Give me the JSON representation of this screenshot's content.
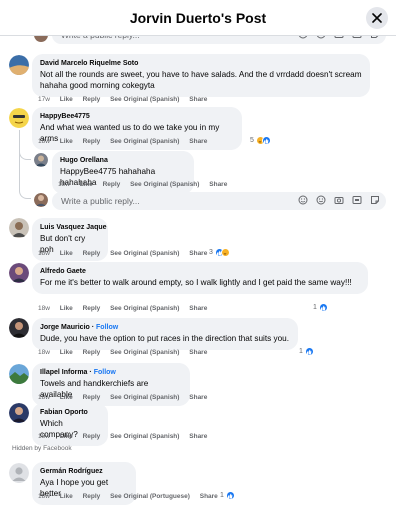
{
  "header": {
    "title": "Jorvin Duerto's Post"
  },
  "reply_placeholder": "Write a public reply...",
  "meta": {
    "like": "Like",
    "reply": "Reply",
    "see_original_spanish": "See Original (Spanish)",
    "see_original_portuguese": "See Original (Portuguese)",
    "share": "Share"
  },
  "comments": [
    {
      "author": "David Marcelo Riquelme Soto",
      "text": "Not all the rounds are sweet, you have to have salads. And the d vrrdadd doesn't scream hahaha good morning cokegyta",
      "time": "17w",
      "reactions": ""
    },
    {
      "author": "HappyBee4775",
      "text": "And what wea wanted us to do we take you in my arms",
      "time": "18w",
      "reactions": "5"
    },
    {
      "author": "Hugo Orellana",
      "text": "HappyBee4775 hahahaha hahahaha",
      "time": "18w",
      "reactions": ""
    },
    {
      "author": "Luis Vasquez Jaque",
      "text": "But don't cry poh",
      "time": "18w",
      "reactions": "3"
    },
    {
      "author": "Alfredo Gaete",
      "text": "For me it's better to walk around empty, so I walk lightly and I get paid the same way!!!",
      "time": "18w",
      "reactions": "1"
    },
    {
      "author": "Jorge Mauricio",
      "follow": "Follow",
      "text": "Dude, you have the option to put races in the direction that suits you.",
      "time": "18w",
      "reactions": "1"
    },
    {
      "author": "Illapel Informa",
      "follow": "Follow",
      "text": "Towels and handkerchiefs are available",
      "time": "18w",
      "reactions": ""
    },
    {
      "author": "Fabian Oporto",
      "text": "Which company?",
      "time": "18w",
      "reactions": ""
    },
    {
      "author": "Germán Rodríguez",
      "text": "Aya I hope you get better",
      "time": "18w",
      "reactions": "1"
    }
  ],
  "hidden_label": "Hidden by Facebook",
  "colors": {
    "accent": "#1877f2",
    "bubble": "#f0f2f5",
    "meta": "#65676b"
  }
}
